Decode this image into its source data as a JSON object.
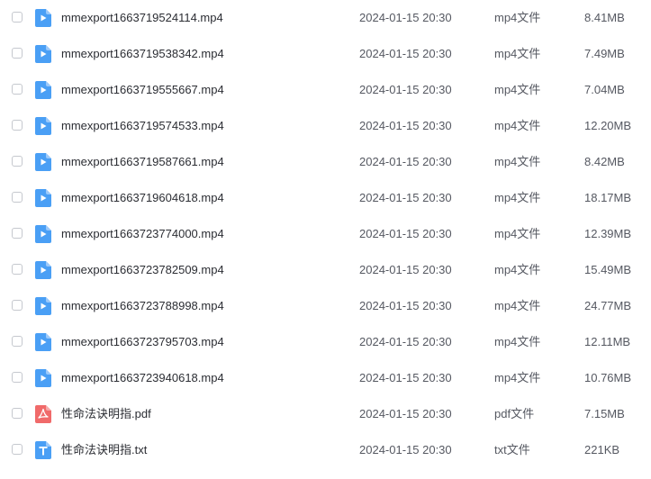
{
  "files": [
    {
      "name": "mmexport1663719524114.mp4",
      "date": "2024-01-15 20:30",
      "type": "mp4文件",
      "size": "8.41MB",
      "icon": "video-file-icon"
    },
    {
      "name": "mmexport1663719538342.mp4",
      "date": "2024-01-15 20:30",
      "type": "mp4文件",
      "size": "7.49MB",
      "icon": "video-file-icon"
    },
    {
      "name": "mmexport1663719555667.mp4",
      "date": "2024-01-15 20:30",
      "type": "mp4文件",
      "size": "7.04MB",
      "icon": "video-file-icon"
    },
    {
      "name": "mmexport1663719574533.mp4",
      "date": "2024-01-15 20:30",
      "type": "mp4文件",
      "size": "12.20MB",
      "icon": "video-file-icon"
    },
    {
      "name": "mmexport1663719587661.mp4",
      "date": "2024-01-15 20:30",
      "type": "mp4文件",
      "size": "8.42MB",
      "icon": "video-file-icon"
    },
    {
      "name": "mmexport1663719604618.mp4",
      "date": "2024-01-15 20:30",
      "type": "mp4文件",
      "size": "18.17MB",
      "icon": "video-file-icon"
    },
    {
      "name": "mmexport1663723774000.mp4",
      "date": "2024-01-15 20:30",
      "type": "mp4文件",
      "size": "12.39MB",
      "icon": "video-file-icon"
    },
    {
      "name": "mmexport1663723782509.mp4",
      "date": "2024-01-15 20:30",
      "type": "mp4文件",
      "size": "15.49MB",
      "icon": "video-file-icon"
    },
    {
      "name": "mmexport1663723788998.mp4",
      "date": "2024-01-15 20:30",
      "type": "mp4文件",
      "size": "24.77MB",
      "icon": "video-file-icon"
    },
    {
      "name": "mmexport1663723795703.mp4",
      "date": "2024-01-15 20:30",
      "type": "mp4文件",
      "size": "12.11MB",
      "icon": "video-file-icon"
    },
    {
      "name": "mmexport1663723940618.mp4",
      "date": "2024-01-15 20:30",
      "type": "mp4文件",
      "size": "10.76MB",
      "icon": "video-file-icon"
    },
    {
      "name": "性命法诀明指.pdf",
      "date": "2024-01-15 20:30",
      "type": "pdf文件",
      "size": "7.15MB",
      "icon": "pdf-file-icon"
    },
    {
      "name": "性命法诀明指.txt",
      "date": "2024-01-15 20:30",
      "type": "txt文件",
      "size": "221KB",
      "icon": "txt-file-icon"
    }
  ],
  "colors": {
    "video_icon": "#4a9ff5",
    "pdf_icon": "#f06a6a",
    "txt_icon": "#4a9ff5",
    "checkbox_border": "#c5c8ce"
  }
}
